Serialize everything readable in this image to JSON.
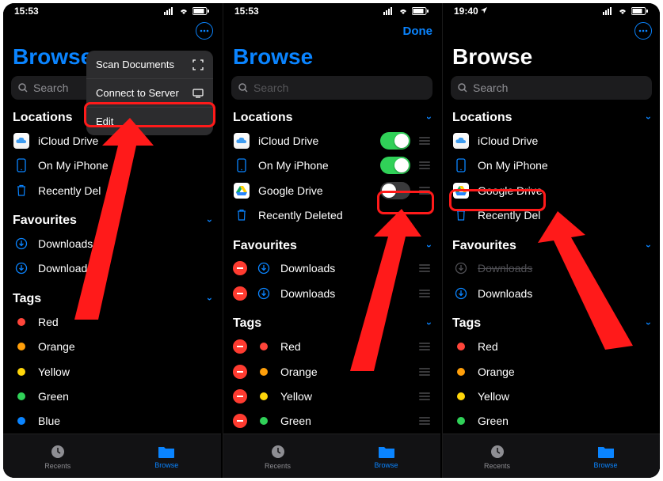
{
  "statusbar": {
    "t1": "15:53",
    "t2": "15:53",
    "t3": "19:40"
  },
  "header": {
    "browse_title": "Browse",
    "done": "Done",
    "search_placeholder": "Search"
  },
  "menu": {
    "scan": "Scan Documents",
    "connect": "Connect to Server",
    "edit": "Edit"
  },
  "sections": {
    "locations": "Locations",
    "favourites": "Favourites",
    "tags": "Tags"
  },
  "locations": {
    "icloud": "iCloud Drive",
    "onmy": "On My iPhone",
    "gdrive": "Google Drive",
    "recently": "Recently Deleted",
    "recently_trunc": "Recently Del"
  },
  "fav": {
    "downloads": "Downloads"
  },
  "tags": {
    "red": "Red",
    "orange": "Orange",
    "yellow": "Yellow",
    "green": "Green",
    "blue": "Blue"
  },
  "colors": {
    "red": "#ff453a",
    "orange": "#ff9f0a",
    "yellow": "#ffd60a",
    "green": "#30d158",
    "blue": "#0a84ff",
    "accent": "#0a84ff",
    "grey": "#8e8e93",
    "toggle_on": "#30d158",
    "toggle_off": "#3a3a3c"
  },
  "tabs": {
    "recents": "Recents",
    "browse": "Browse"
  }
}
